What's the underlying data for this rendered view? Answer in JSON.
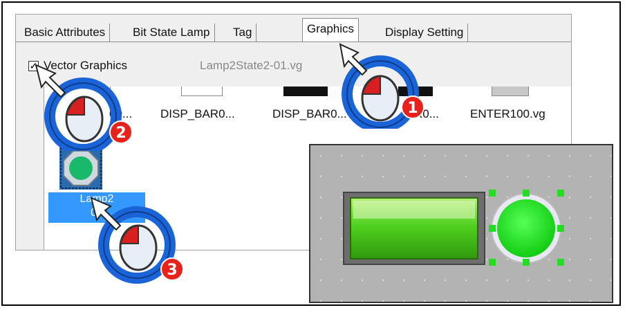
{
  "tabs": [
    {
      "label": "Basic Attributes",
      "active": false
    },
    {
      "label": "Bit State Lamp",
      "active": false
    },
    {
      "label": "Tag",
      "active": false
    },
    {
      "label": "Graphics",
      "active": true
    },
    {
      "label": "Display Setting",
      "active": false
    }
  ],
  "vector_graphics": {
    "checked": true,
    "check_mark": "✓",
    "label": "Vector Graphics",
    "filename": "Lamp2State2-01.vg"
  },
  "files": [
    {
      "label": "DISP_BAR0..."
    },
    {
      "label": "DISP_BAR0..."
    },
    {
      "label": "ENTER100.vg"
    }
  ],
  "partial_labels": {
    "first": "00...",
    "third": "R0..."
  },
  "selected_file": {
    "line1": "Lamp2",
    "line2": "01"
  },
  "steps": [
    "1",
    "2",
    "3"
  ],
  "colors": {
    "accent_blue": "#3399ff",
    "badge_red": "#e8221b",
    "lamp_green": "#22dd22",
    "preview_bg": "#b3b3b3"
  },
  "icons": [
    "mouse-click-icon",
    "cursor-arrow-icon",
    "lamp-icon",
    "octagon-lamp-icon"
  ]
}
